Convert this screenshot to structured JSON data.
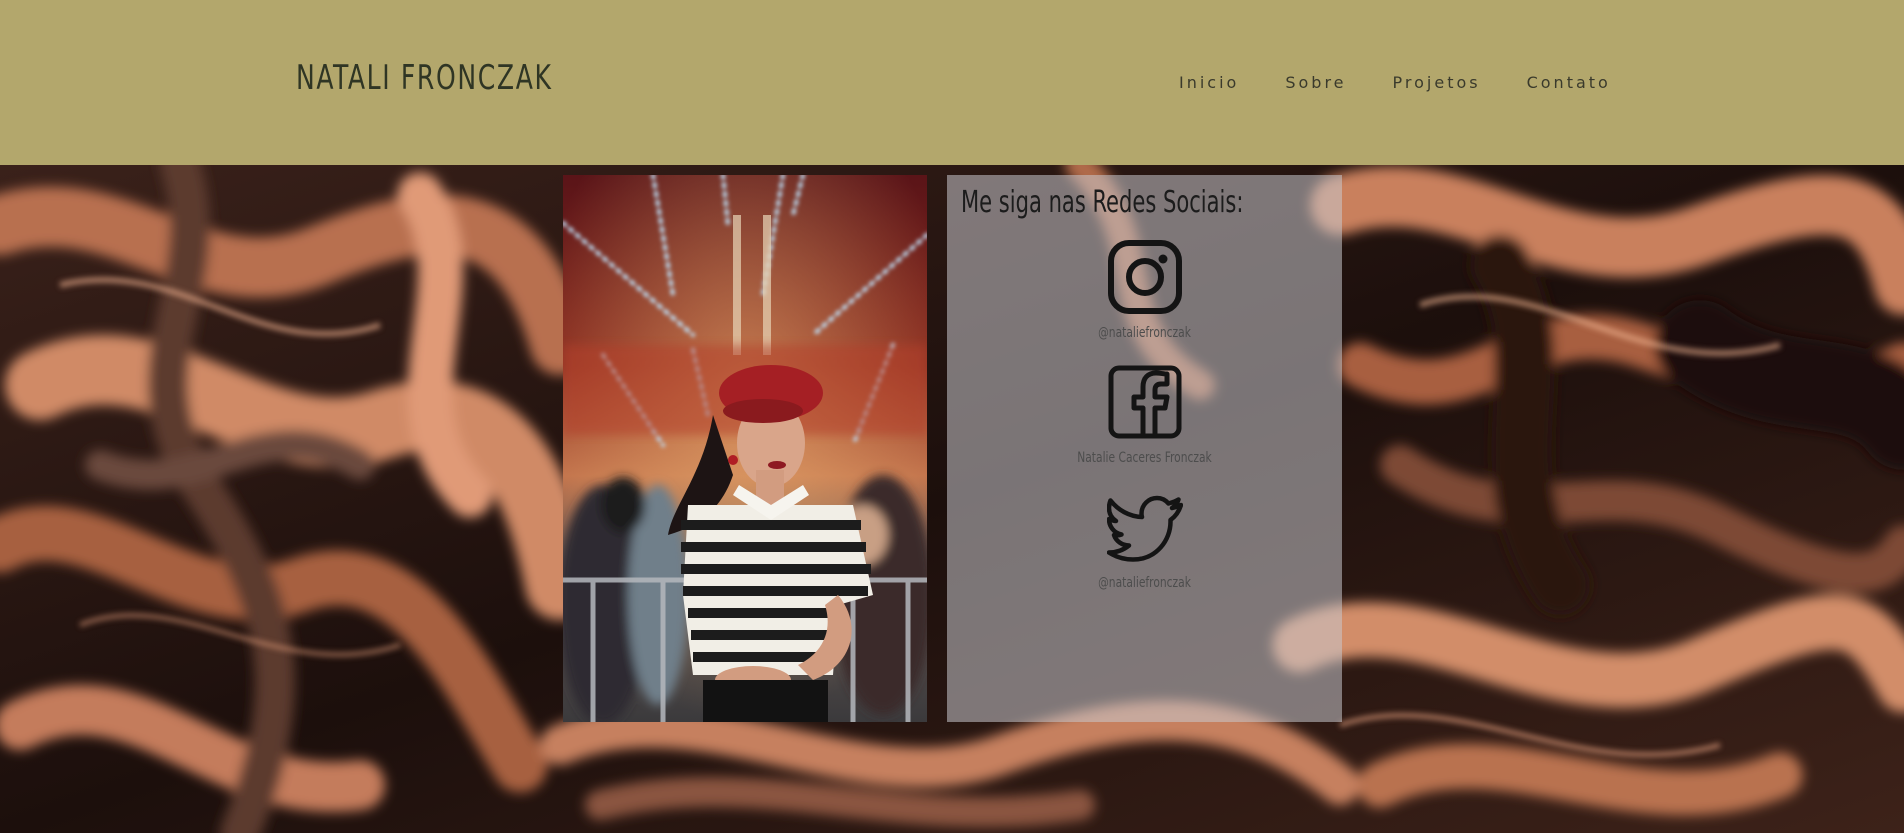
{
  "header": {
    "logo": "NATALI FRONCZAK",
    "background": "#b3a76c",
    "nav": [
      {
        "label": "Inicio"
      },
      {
        "label": "Sobre"
      },
      {
        "label": "Projetos"
      },
      {
        "label": "Contato"
      }
    ]
  },
  "social": {
    "title": "Me siga nas Redes Sociais:",
    "items": [
      {
        "icon": "instagram-icon",
        "label": "@nataliefronczak"
      },
      {
        "icon": "facebook-icon",
        "label": "Natalie Caceres Fronczak"
      },
      {
        "icon": "twitter-icon",
        "label": "@nataliefronczak"
      }
    ]
  },
  "colors": {
    "swirl_dark": "#2a1712",
    "swirl_copper": "#c87a5a",
    "panel": "rgba(200,200,205,0.55)"
  }
}
